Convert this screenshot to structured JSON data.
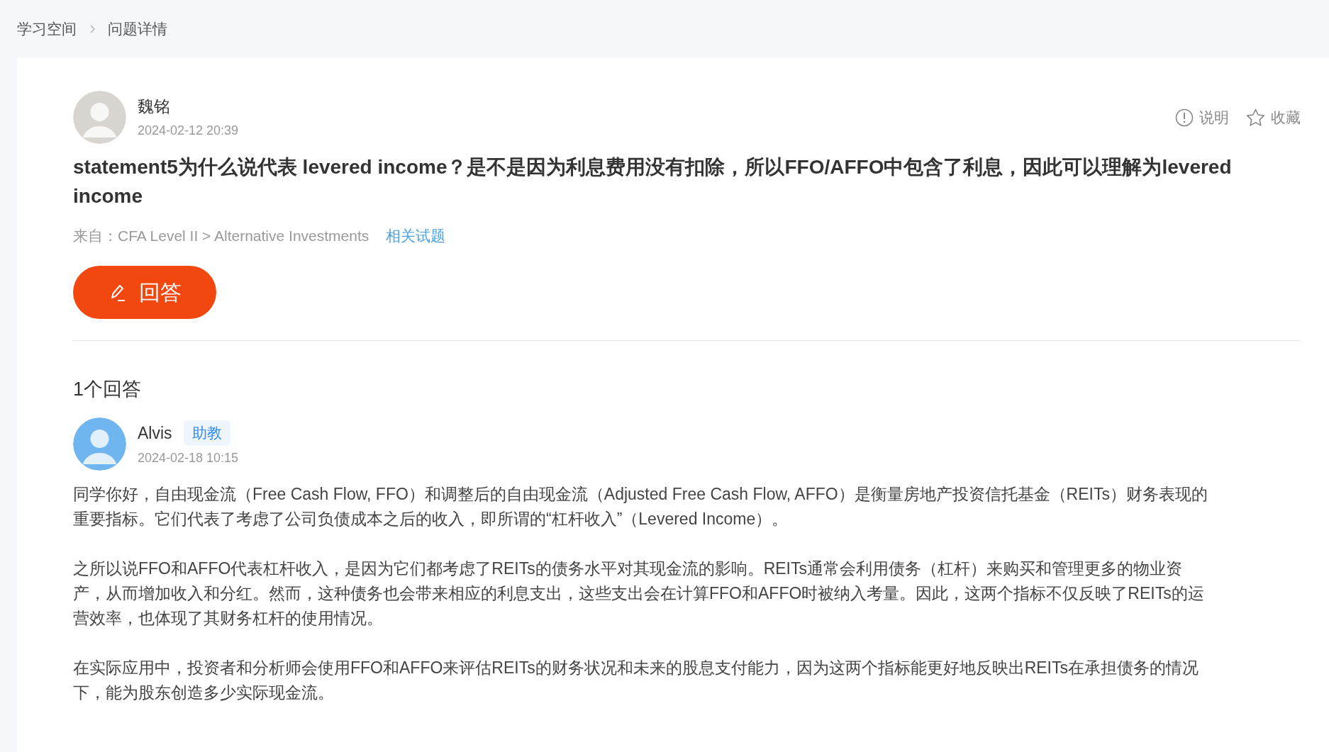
{
  "breadcrumb": [
    "学习空间",
    "问题详情"
  ],
  "question": {
    "author": "魏铭",
    "date": "2024-02-12 20:39",
    "actions": [
      "说明",
      "收藏"
    ],
    "title": "statement5为什么说代表 levered income？是不是因为利息费用没有扣除，所以FFO/AFFO中包含了利息，因此可以理解为levered income",
    "source": "来自：CFA Level II > Alternative Investments",
    "related_link": "相关试题",
    "answer_button": "回答"
  },
  "answers_heading": "1个回答",
  "answers": [
    {
      "author": "Alvis",
      "badge": "助教",
      "date": "2024-02-18 10:15",
      "paragraphs": [
        "同学你好，自由现金流（Free Cash Flow, FFO）和调整后的自由现金流（Adjusted Free Cash Flow, AFFO）是衡量房地产投资信托基金（REITs）财务表现的重要指标。它们代表了考虑了公司负债成本之后的收入，即所谓的“杠杆收入”（Levered Income）。",
        "之所以说FFO和AFFO代表杠杆收入，是因为它们都考虑了REITs的债务水平对其现金流的影响。REITs通常会利用债务（杠杆）来购买和管理更多的物业资产，从而增加收入和分红。然而，这种债务也会带来相应的利息支出，这些支出会在计算FFO和AFFO时被纳入考量。因此，这两个指标不仅反映了REITs的运营效率，也体现了其财务杠杆的使用情况。",
        "在实际应用中，投资者和分析师会使用FFO和AFFO来评估REITs的财务状况和未来的股息支付能力，因为这两个指标能更好地反映出REITs在承担债务的情况下，能为股东创造多少实际现金流。"
      ]
    }
  ]
}
